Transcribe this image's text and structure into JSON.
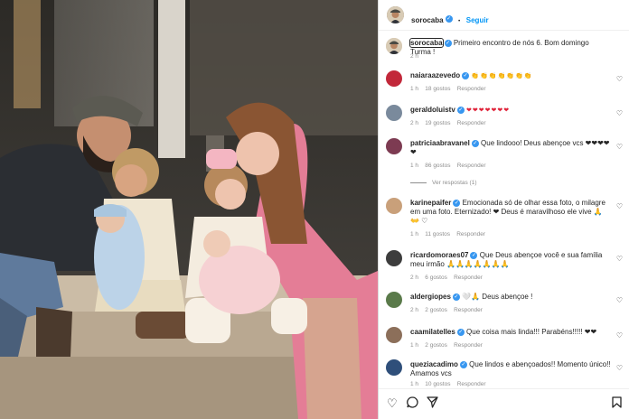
{
  "header": {
    "username": "sorocaba",
    "separator": "•",
    "follow_label": "Seguir"
  },
  "caption": {
    "username": "sorocaba",
    "text": "Primeiro encontro de nós 6. Bom domingo Turma !",
    "time": "2 h"
  },
  "comments": [
    {
      "username": "naiaraazevedo",
      "text": "",
      "emojis": "👏👏👏👏👏👏👏",
      "time": "1 h",
      "likes": "18 gostos",
      "reply": "Responder"
    },
    {
      "username": "geraldoluistv",
      "text": "",
      "emojis": "❤❤❤❤❤❤❤",
      "time": "2 h",
      "likes": "19 gostos",
      "reply": "Responder"
    },
    {
      "username": "patriciaabravanel",
      "text": "Que lindooo! Deus abençoe vcs ❤❤❤❤❤",
      "time": "1 h",
      "likes": "86 gostos",
      "reply": "Responder",
      "view_replies": "Ver respostas (1)"
    },
    {
      "username": "karinepaifer",
      "text": "Emocionada só de olhar essa foto, o milagre em uma foto. Eternizado! ❤ Deus é maravilhoso ele vive 🙏👐 ♡",
      "time": "1 h",
      "likes": "11 gostos",
      "reply": "Responder"
    },
    {
      "username": "ricardomoraes07",
      "text": "Que Deus abençoe você e sua família meu irmão 🙏🙏🙏🙏🙏🙏🙏",
      "time": "2 h",
      "likes": "6 gostos",
      "reply": "Responder"
    },
    {
      "username": "aldergiopes",
      "text": "🤍🙏 Deus abençoe !",
      "time": "2 h",
      "likes": "2 gostos",
      "reply": "Responder"
    },
    {
      "username": "caamilatelles",
      "text": "Que coisa mais linda!!! Parabéns!!!!! ❤❤",
      "time": "1 h",
      "likes": "2 gostos",
      "reply": "Responder"
    },
    {
      "username": "queziacadimo",
      "text": "Que lindos e abençoados!! Momento único!! Amamos vcs",
      "time": "1 h",
      "likes": "10 gostos",
      "reply": "Responder"
    }
  ],
  "footer_icons": [
    "heart-icon",
    "comment-icon",
    "share-icon",
    "bookmark-icon"
  ],
  "colors": {
    "accent": "#0095f6",
    "verified": "#3897f0",
    "heart": "#e0243a",
    "text": "#262626",
    "meta": "#8e8e8e"
  }
}
